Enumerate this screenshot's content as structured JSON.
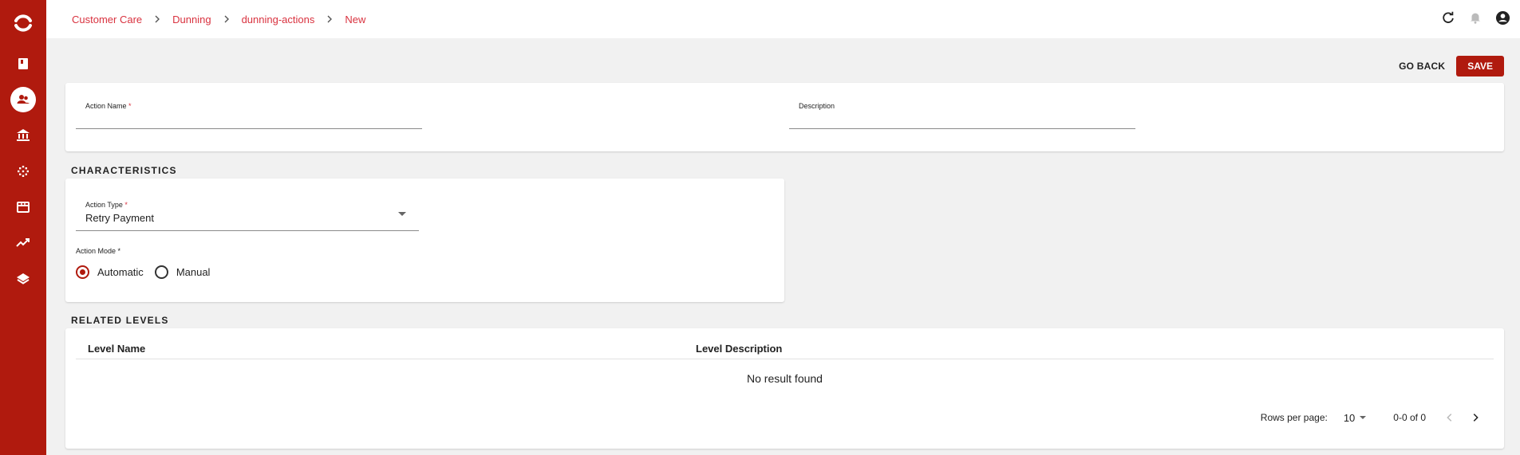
{
  "theme": {
    "accent": "#b01a0e",
    "link": "#d9323f"
  },
  "sidebar": {
    "logo_icon": "app-logo-icon",
    "items": [
      {
        "icon": "book-icon",
        "active": false
      },
      {
        "icon": "customers-icon",
        "active": true
      },
      {
        "icon": "bank-icon",
        "active": false
      },
      {
        "icon": "dots-grid-icon",
        "active": false
      },
      {
        "icon": "store-icon",
        "active": false
      },
      {
        "icon": "trending-up-icon",
        "active": false
      },
      {
        "icon": "layers-icon",
        "active": false
      }
    ]
  },
  "breadcrumb": [
    "Customer Care",
    "Dunning",
    "dunning-actions",
    "New"
  ],
  "topbar": {
    "icons": [
      "refresh-icon",
      "bell-icon",
      "account-icon"
    ]
  },
  "actions": {
    "go_back": "GO BACK",
    "save": "SAVE"
  },
  "form": {
    "action_name": {
      "label": "Action Name",
      "required": "*",
      "value": ""
    },
    "description": {
      "label": "Description",
      "value": ""
    }
  },
  "characteristics": {
    "title": "CHARACTERISTICS",
    "action_type": {
      "label": "Action Type",
      "required": "*",
      "value": "Retry Payment"
    },
    "action_mode": {
      "label": "Action Mode *",
      "options": [
        {
          "label": "Automatic",
          "checked": true
        },
        {
          "label": "Manual",
          "checked": false
        }
      ]
    }
  },
  "related_levels": {
    "title": "RELATED LEVELS",
    "columns": [
      "Level Name",
      "Level Description"
    ],
    "empty": "No result found",
    "pagination": {
      "rows_per_page_label": "Rows per page:",
      "rows_per_page": "10",
      "range": "0-0 of 0"
    }
  }
}
